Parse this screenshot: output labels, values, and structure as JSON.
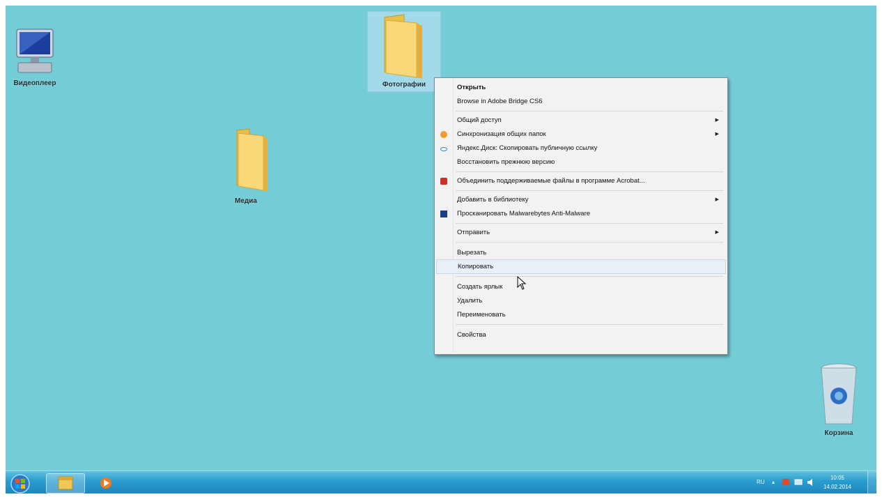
{
  "desktop": {
    "icons": [
      {
        "label": "Видеоплеер",
        "kind": "computer"
      },
      {
        "label": "Фотографии",
        "kind": "folder"
      },
      {
        "label": "Медиа",
        "kind": "folder"
      },
      {
        "label": "Корзина",
        "kind": "recycle-bin"
      }
    ]
  },
  "context_menu": {
    "items": [
      {
        "label": "Открыть"
      },
      {
        "label": "Browse in Adobe Bridge CS6"
      },
      {
        "label": "Общий доступ"
      },
      {
        "label": "Синхронизация общих папок"
      },
      {
        "label": "Яндекс.Диск: Скопировать публичную ссылку"
      },
      {
        "label": "Восстановить прежнюю версию"
      },
      {
        "label": "Объединить поддерживаемые файлы в программе Acrobat..."
      },
      {
        "label": "Добавить в библиотеку"
      },
      {
        "label": "Просканировать Malwarebytes Anti-Malware"
      },
      {
        "label": "Отправить"
      },
      {
        "label": "Вырезать"
      },
      {
        "label": "Копировать"
      },
      {
        "label": "Создать ярлык"
      },
      {
        "label": "Удалить"
      },
      {
        "label": "Переименовать"
      },
      {
        "label": "Свойства"
      }
    ],
    "submenu_arrow": "▶",
    "highlighted_item": "Копировать"
  },
  "taskbar": {
    "tray": {
      "language": "RU",
      "time": "10:05",
      "date": "14.02.2014"
    }
  },
  "colors": {
    "desktop": "#74ccd6",
    "taskbar": "#2c9ed0",
    "menu_bg": "#f2f2f2"
  }
}
